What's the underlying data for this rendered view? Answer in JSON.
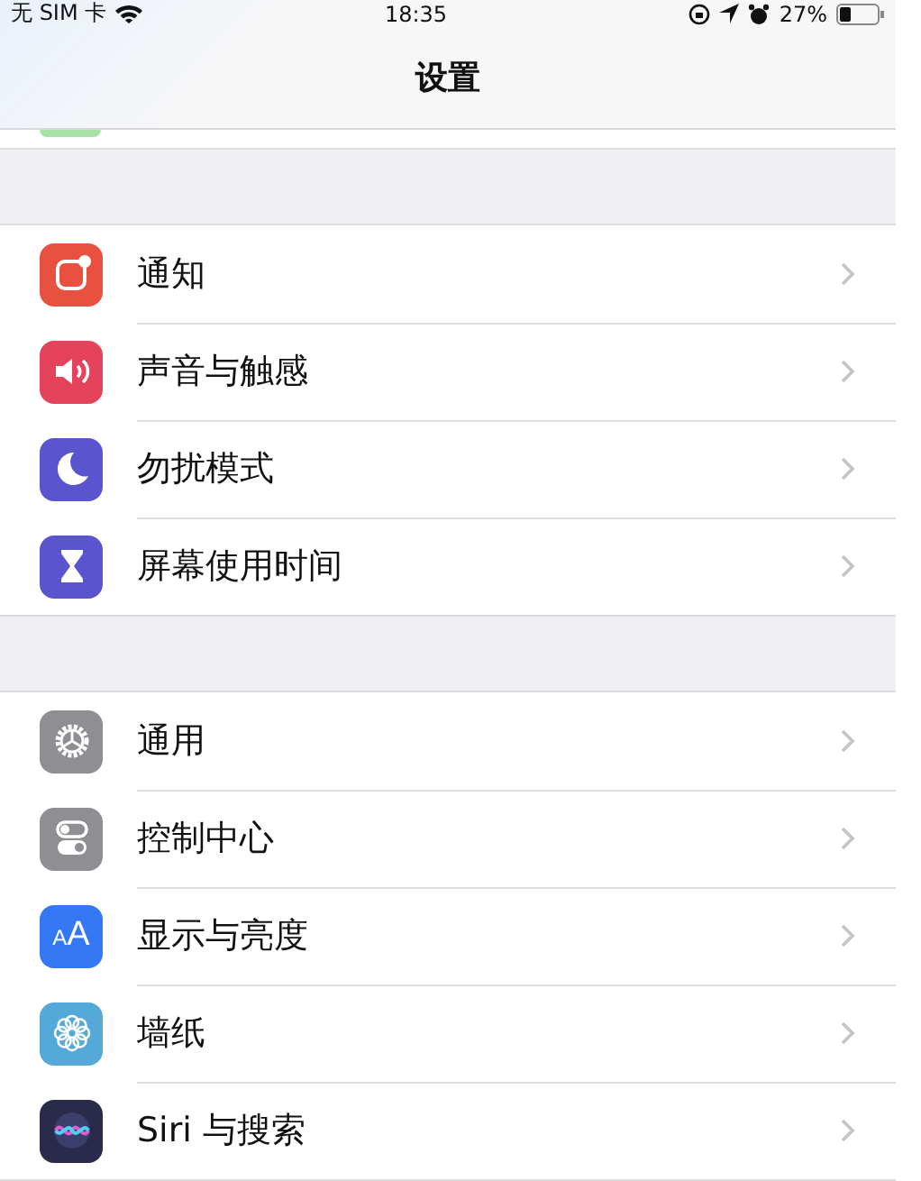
{
  "status_bar": {
    "carrier": "无 SIM 卡",
    "time": "18:35",
    "battery_text": "27%"
  },
  "nav_bar": {
    "title": "设置"
  },
  "groups": [
    {
      "items": [
        {
          "kind": "notifications",
          "color": "#e8503f",
          "label": "通知"
        },
        {
          "kind": "sound",
          "color": "#e5425b",
          "label": "声音与触感"
        },
        {
          "kind": "moon",
          "color": "#5a55cf",
          "label": "勿扰模式"
        },
        {
          "kind": "hourglass",
          "color": "#5a55cf",
          "label": "屏幕使用时间"
        }
      ]
    },
    {
      "items": [
        {
          "kind": "gear",
          "color": "#8e8e93",
          "label": "通用"
        },
        {
          "kind": "toggles",
          "color": "#8e8e93",
          "label": "控制中心"
        },
        {
          "kind": "text",
          "color": "#3478f6",
          "label": "显示与亮度",
          "icon_text": "AA"
        },
        {
          "kind": "flower",
          "color": "#55a9d9",
          "label": "墙纸"
        },
        {
          "kind": "siri",
          "color": "#2a2a4a",
          "label": "Siri 与搜索"
        }
      ]
    }
  ]
}
